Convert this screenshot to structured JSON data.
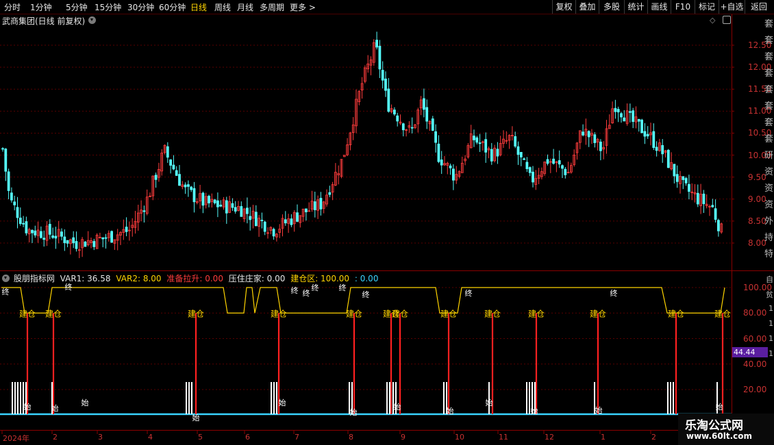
{
  "toolbar": {
    "periods": [
      "分时",
      "1分钟",
      "5分钟",
      "15分钟",
      "30分钟",
      "60分钟",
      "日线",
      "周线",
      "月线",
      "多周期",
      "更多 >"
    ],
    "active_period": "日线",
    "right_buttons": [
      "复权",
      "叠加",
      "多股",
      "统计",
      "画线",
      "F10",
      "标记",
      "+自选",
      "返回"
    ]
  },
  "chart": {
    "title": "武商集团(日线 前复权)",
    "y_ticks": [
      "12.50",
      "12.00",
      "11.50",
      "11.00",
      "10.50",
      "10.00",
      "9.50",
      "9.00",
      "8.50",
      "8.00"
    ]
  },
  "indicator": {
    "name": "股朋指标网",
    "var1": "VAR1: 36.58",
    "var2": "VAR2: 8.00",
    "zhunbei": "准备拉升: 0.00",
    "yazhu": "压住庄家: 0.00",
    "jiancang_label": "建仓区: 100.00",
    "extra": ": 0.00",
    "y_ticks": [
      "100.00",
      "80.00",
      "60.00",
      "40.00",
      "20.00"
    ],
    "current_value": "44.44",
    "signal_jian": "建仓",
    "signal_zhong": "终",
    "signal_shi": "始"
  },
  "x_axis": {
    "labels": [
      "2024年",
      "2",
      "3",
      "4",
      "5",
      "6",
      "7",
      "8",
      "9",
      "10",
      "11",
      "12",
      "1",
      "2"
    ]
  },
  "side_text": [
    "套",
    "套",
    "套",
    "套",
    "套",
    "套",
    "套",
    "套",
    "研",
    "资",
    "资",
    "资",
    "外",
    "持",
    "特"
  ],
  "side_text2": [
    "自",
    "贫",
    "1",
    "1",
    "1",
    "1"
  ],
  "watermark": {
    "name": "乐淘公式网",
    "url": "www.60lt.com"
  },
  "colors": {
    "up": "#ff3c3c",
    "down": "#54fcfc",
    "line": "#ffd400",
    "base": "#3ad4ff",
    "grid": "#5a0000"
  }
}
